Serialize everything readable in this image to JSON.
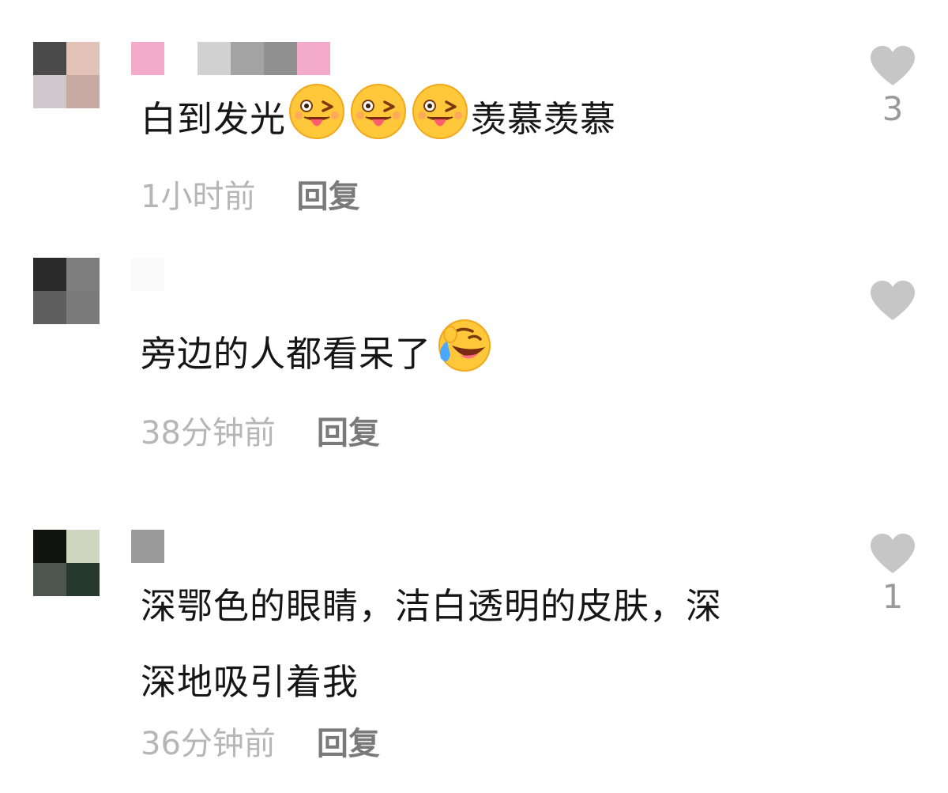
{
  "comments": [
    {
      "text_before": "白到发光",
      "emojis": [
        "tongue-wink-emoji",
        "tongue-wink-emoji",
        "tongue-wink-emoji"
      ],
      "text_after": "羡慕羡慕",
      "time": "1小时前",
      "reply": "回复",
      "likes": "3",
      "avatar_colors": [
        "#4a4a4a",
        "#e2c2b6",
        "#cfc8cd",
        "#c9aaa3"
      ],
      "name_colors": [
        "#f4aacb",
        "#ffffff",
        "#d1d1d1",
        "#a3a3a3",
        "#909090",
        "#f4aacb"
      ]
    },
    {
      "text_before": "旁边的人都看呆了",
      "emojis": [
        "laughing-tears-emoji"
      ],
      "text_after": "",
      "time": "38分钟前",
      "reply": "回复",
      "likes": "",
      "avatar_colors": [
        "#2a2a2a",
        "#7e7e7e",
        "#5e5e5e",
        "#7a7a7a"
      ],
      "name_colors": [
        "#fafafa",
        "#ffffff",
        "#ffffff"
      ]
    },
    {
      "text_line1": "深鄂色的眼睛，洁白透明的皮肤，深",
      "text_line2": "深地吸引着我",
      "time": "36分钟前",
      "reply": "回复",
      "likes": "1",
      "avatar_colors": [
        "#0f140f",
        "#d0d5c0",
        "#4e5450",
        "#26392c"
      ],
      "name_colors": [
        "#9a9a9a"
      ]
    }
  ],
  "icons": {
    "like": "heart-icon"
  },
  "colors": {
    "heart": "#c6c6c6",
    "time": "#b6b6b6",
    "reply": "#7a7a7a"
  }
}
